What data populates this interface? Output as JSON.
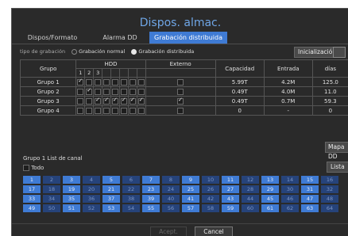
{
  "title": "Dispos. almac.",
  "tabs": [
    {
      "label": "Dispos/Formato",
      "active": false
    },
    {
      "label": "Alarma DD",
      "active": false
    },
    {
      "label": "Grabación distribuida",
      "active": true
    }
  ],
  "recording_type": {
    "label": "tipo de grabación",
    "options": [
      {
        "label": "Grabación normal",
        "selected": false
      },
      {
        "label": "Grabación distribuida",
        "selected": true
      }
    ]
  },
  "init_button": "Inicialización",
  "table": {
    "headers": {
      "group": "Grupo",
      "hdd": "HDD",
      "external": "Externo",
      "capacity": "Capacidad",
      "input": "Entrada",
      "days": "días"
    },
    "hdd_numbers": [
      "1",
      "2",
      "3"
    ],
    "rows": [
      {
        "group": "Grupo 1",
        "hdd": [
          true,
          false,
          false,
          false,
          false,
          false,
          false,
          false
        ],
        "external": false,
        "capacity": "5.99T",
        "input": "4.2M",
        "days": "125.0"
      },
      {
        "group": "Grupo 2",
        "hdd": [
          false,
          true,
          false,
          false,
          false,
          false,
          false,
          false
        ],
        "external": false,
        "capacity": "0.49T",
        "input": "4.0M",
        "days": "11.0"
      },
      {
        "group": "Grupo 3",
        "hdd": [
          false,
          false,
          true,
          true,
          true,
          true,
          true,
          true
        ],
        "external": true,
        "capacity": "0.49T",
        "input": "0.7M",
        "days": "59.3"
      },
      {
        "group": "Grupo 4",
        "hdd": [
          false,
          false,
          false,
          false,
          false,
          false,
          false,
          false
        ],
        "external": false,
        "capacity": "0",
        "input": "-",
        "days": "0"
      }
    ]
  },
  "map_button": "Mapa DD",
  "channel_list": {
    "title": "Grupo 1 List de canal",
    "all_label": "Todo",
    "list_button": "Lista",
    "channels": [
      [
        "1",
        "2",
        "3",
        "4",
        "5",
        "6",
        "7",
        "8",
        "9",
        "10",
        "11",
        "12",
        "13",
        "14",
        "15",
        "16"
      ],
      [
        "17",
        "18",
        "19",
        "20",
        "21",
        "22",
        "23",
        "24",
        "25",
        "26",
        "27",
        "28",
        "29",
        "30",
        "31",
        "32"
      ],
      [
        "33",
        "34",
        "35",
        "36",
        "37",
        "38",
        "39",
        "40",
        "41",
        "42",
        "43",
        "44",
        "45",
        "46",
        "47",
        "48"
      ],
      [
        "49",
        "50",
        "51",
        "52",
        "53",
        "54",
        "55",
        "56",
        "57",
        "58",
        "59",
        "60",
        "61",
        "62",
        "63",
        "64"
      ]
    ],
    "dim_channels": [
      "2",
      "4",
      "6",
      "8",
      "10",
      "12",
      "14",
      "16",
      "18",
      "20",
      "22",
      "24",
      "26",
      "28",
      "30",
      "32",
      "34",
      "36",
      "38",
      "40",
      "42",
      "44",
      "46",
      "48",
      "50",
      "52",
      "54",
      "56",
      "58",
      "60",
      "62",
      "64"
    ]
  },
  "footer": {
    "accept": "Acept.",
    "cancel": "Cancel"
  }
}
